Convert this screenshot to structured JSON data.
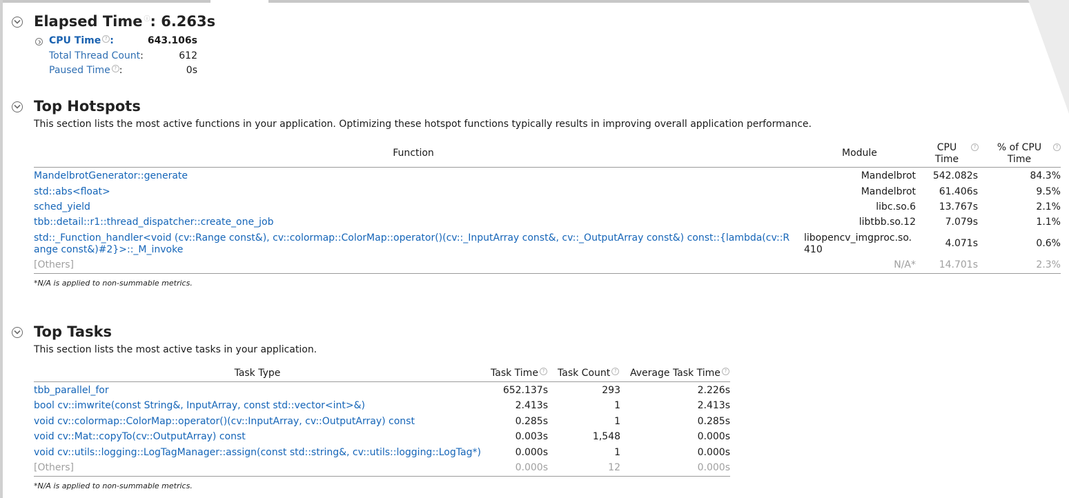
{
  "elapsed": {
    "title": "Elapsed Time",
    "value": ": 6.263s",
    "metrics": [
      {
        "label": "CPU Time",
        "value": "643.106s"
      },
      {
        "label": "Total Thread Count",
        "value": "612"
      },
      {
        "label": "Paused Time",
        "value": "0s"
      }
    ]
  },
  "hotspots": {
    "title": "Top Hotspots",
    "description": "This section lists the most active functions in your application. Optimizing these hotspot functions typically results in improving overall application performance.",
    "columns": {
      "function": "Function",
      "module": "Module",
      "cpu_time_1": "CPU",
      "cpu_time_2": "Time",
      "pct_1": "% of CPU",
      "pct_2": "Time"
    },
    "rows": [
      {
        "function": "MandelbrotGenerator::generate",
        "module": "Mandelbrot",
        "cpu": "542.082s",
        "pct": "84.3%"
      },
      {
        "function": "std::abs<float>",
        "module": "Mandelbrot",
        "cpu": "61.406s",
        "pct": "9.5%"
      },
      {
        "function": "sched_yield",
        "module": "libc.so.6",
        "cpu": "13.767s",
        "pct": "2.1%"
      },
      {
        "function": "tbb::detail::r1::thread_dispatcher::create_one_job",
        "module": "libtbb.so.12",
        "cpu": "7.079s",
        "pct": "1.1%"
      },
      {
        "function_line1": "std::_Function_handler<void (cv::Range const&), cv::colormap::ColorMap::operator()(cv::_InputArray const&, cv::_OutputArray const&) const::{lambda(cv::R",
        "function_line2": "ange const&)#2}>::_M_invoke",
        "module_line1": "libopencv_imgproc.so.",
        "module_line2": "410",
        "cpu": "4.071s",
        "pct": "0.6%"
      }
    ],
    "others": {
      "label": "[Others]",
      "module": "N/A*",
      "cpu": "14.701s",
      "pct": "2.3%"
    },
    "footnote": "*N/A is applied to non-summable metrics."
  },
  "tasks": {
    "title": "Top Tasks",
    "description": "This section lists the most active tasks in your application.",
    "columns": {
      "type": "Task Type",
      "time": "Task Time",
      "count": "Task Count",
      "avg": "Average Task Time"
    },
    "rows": [
      {
        "type": "tbb_parallel_for",
        "time": "652.137s",
        "count": "293",
        "avg": "2.226s"
      },
      {
        "type": "bool cv::imwrite(const String&, InputArray, const std::vector<int>&)",
        "time": "2.413s",
        "count": "1",
        "avg": "2.413s"
      },
      {
        "type": "void cv::colormap::ColorMap::operator()(cv::InputArray, cv::OutputArray) const",
        "time": "0.285s",
        "count": "1",
        "avg": "0.285s"
      },
      {
        "type": "void cv::Mat::copyTo(cv::OutputArray) const",
        "time": "0.003s",
        "count": "1,548",
        "avg": "0.000s"
      },
      {
        "type": "void cv::utils::logging::LogTagManager::assign(const std::string&, cv::utils::logging::LogTag*)",
        "time": "0.000s",
        "count": "1",
        "avg": "0.000s"
      }
    ],
    "others": {
      "label": "[Others]",
      "time": "0.000s",
      "count": "12",
      "avg": "0.000s"
    },
    "footnote": "*N/A is applied to non-summable metrics."
  },
  "icons": {
    "collapse": "collapse-circle-icon",
    "expand": "expand-circle-icon",
    "help": "help-icon"
  },
  "colors": {
    "link": "#1565b8",
    "heading": "#222222",
    "muted": "#a0a0a0"
  }
}
